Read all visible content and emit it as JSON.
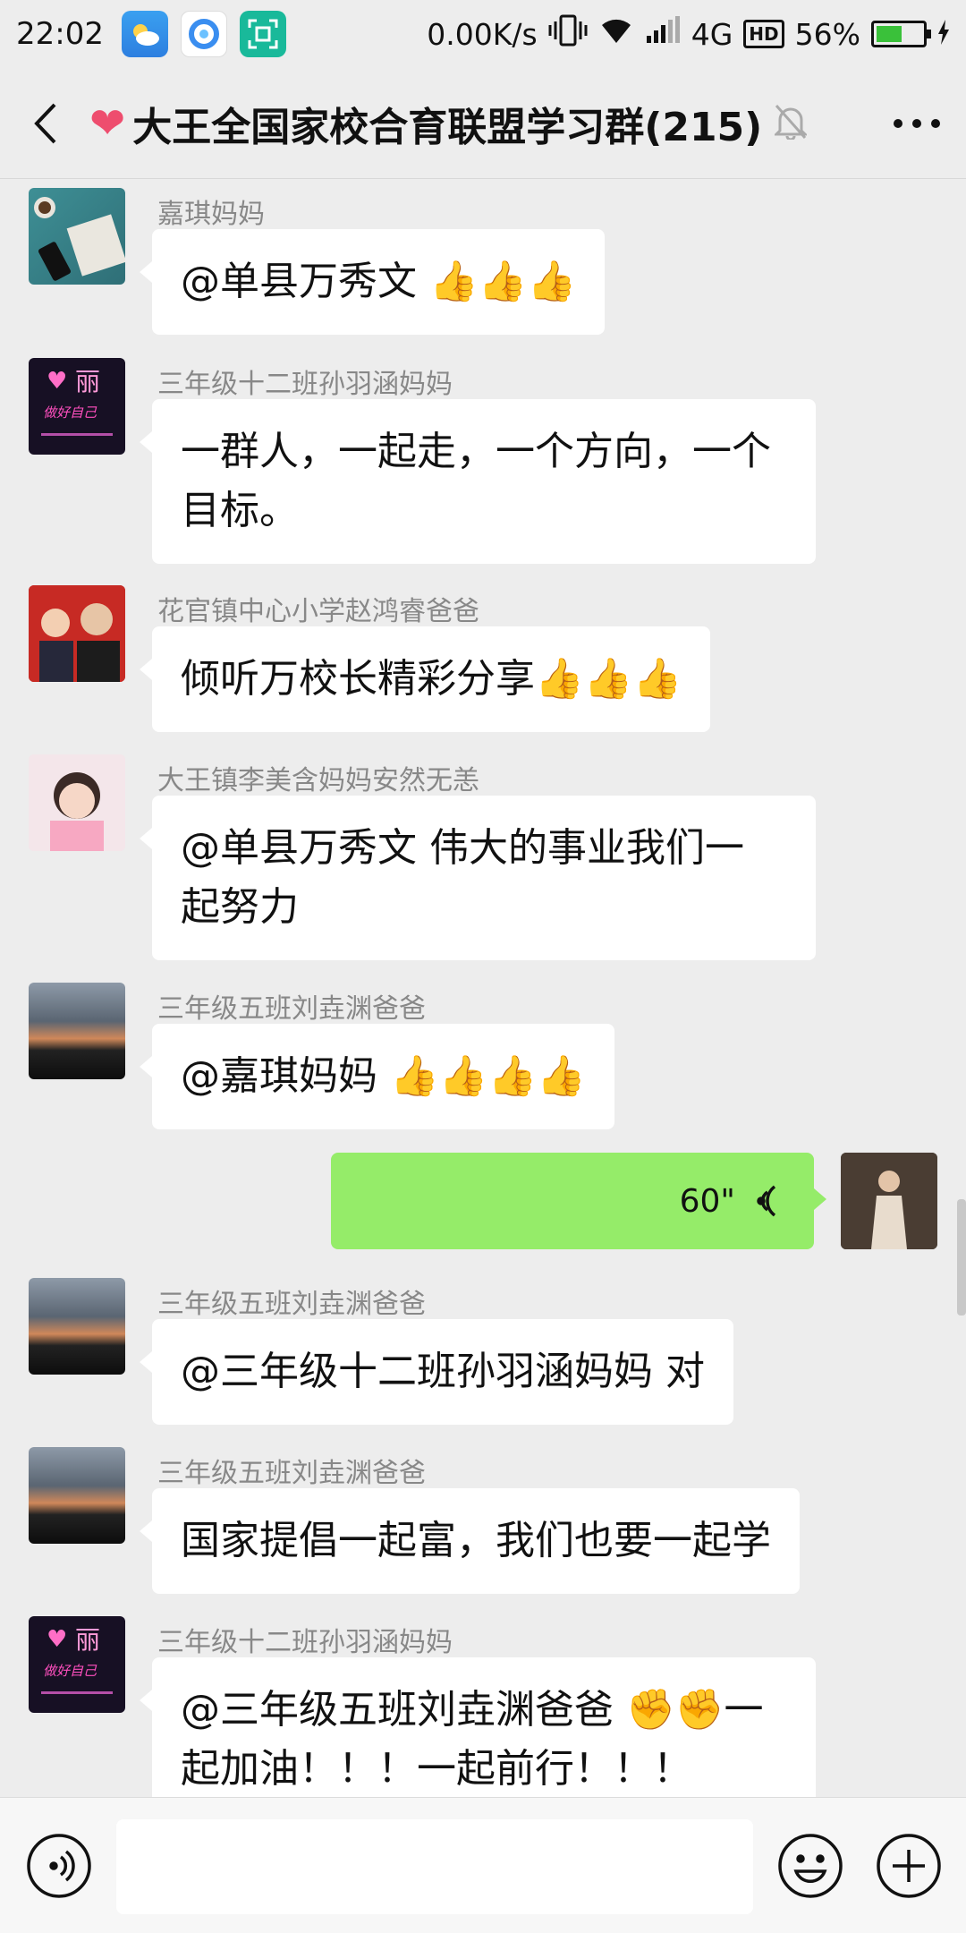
{
  "status_bar": {
    "time": "22:02",
    "net_speed": "0.00K/s",
    "network": "4G",
    "hd": "HD",
    "battery": "56%",
    "battery_level": 0.56
  },
  "header": {
    "title": "大王全国家校合育联盟学习群(215)",
    "heart": "❤"
  },
  "messages": [
    {
      "sender": "嘉琪妈妈",
      "text": "@单县万秀文 👍👍👍"
    },
    {
      "sender": "三年级十二班孙羽涵妈妈",
      "line1": "一群人，一起走，一个方向，一个",
      "line2": "目标。"
    },
    {
      "sender": "花官镇中心小学赵鸿睿爸爸",
      "text": "倾听万校长精彩分享👍👍👍"
    },
    {
      "sender": "大王镇李美含妈妈安然无恙",
      "line1": "@单县万秀文  伟大的事业我们一",
      "line2": "起努力"
    },
    {
      "sender": "三年级五班刘垚渊爸爸",
      "text": "@嘉琪妈妈 👍👍👍👍"
    },
    {
      "voice_duration": "60\""
    },
    {
      "sender": "三年级五班刘垚渊爸爸",
      "text": "@三年级十二班孙羽涵妈妈  对"
    },
    {
      "sender": "三年级五班刘垚渊爸爸",
      "text": "国家提倡一起富，我们也要一起学"
    },
    {
      "sender": "三年级十二班孙羽涵妈妈",
      "line1": "@三年级五班刘垚渊爸爸 ✊✊一",
      "line2": "起加油！！！一起前行！！！"
    }
  ],
  "avatar_text": {
    "li_top": "丽",
    "li_script": "做好自己"
  },
  "colors": {
    "background": "#ededed",
    "bubble_self": "#95ec69",
    "bubble_other": "#ffffff",
    "nick": "#888888"
  },
  "icons": [
    "back-icon",
    "mute-icon",
    "more-icon",
    "voice-toggle-icon",
    "emoji-icon",
    "plus-icon",
    "wifi-icon",
    "signal-icon",
    "vibrate-icon",
    "battery-icon"
  ]
}
